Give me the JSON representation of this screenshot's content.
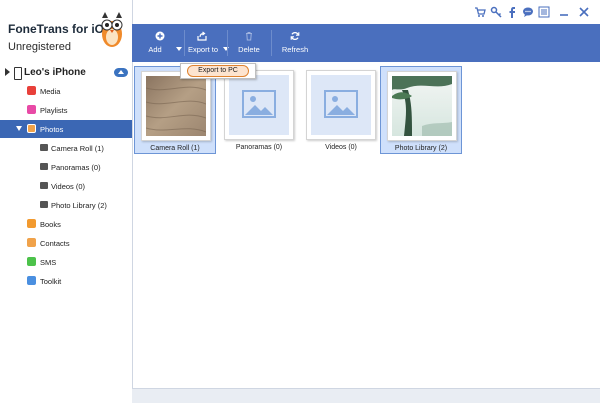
{
  "app": {
    "name": "FoneTrans for iOS",
    "status": "Unregistered"
  },
  "device": {
    "name": "Leo's iPhone"
  },
  "sidebar": {
    "items": [
      {
        "label": "Media",
        "icon": "media-icon",
        "color": "#e8403a"
      },
      {
        "label": "Playlists",
        "icon": "playlist-icon",
        "color": "#e84aa6"
      },
      {
        "label": "Photos",
        "icon": "photos-icon",
        "color": "#f0a24a"
      },
      {
        "label": "Camera Roll (1)",
        "icon": "camera-icon"
      },
      {
        "label": "Panoramas (0)",
        "icon": "camera-icon"
      },
      {
        "label": "Videos (0)",
        "icon": "camera-icon"
      },
      {
        "label": "Photo Library (2)",
        "icon": "camera-icon"
      },
      {
        "label": "Books",
        "icon": "books-icon",
        "color": "#f29a2f"
      },
      {
        "label": "Contacts",
        "icon": "contacts-icon",
        "color": "#f0a24a"
      },
      {
        "label": "SMS",
        "icon": "sms-icon",
        "color": "#4cc24a"
      },
      {
        "label": "Toolkit",
        "icon": "toolkit-icon",
        "color": "#4a8fe0"
      }
    ]
  },
  "toolbar": {
    "add": "Add",
    "export": "Export to",
    "delete": "Delete",
    "refresh": "Refresh",
    "background": "#4a6fbe"
  },
  "dropdown": {
    "export_pc": "Export to PC"
  },
  "albums": [
    {
      "caption": "Camera Roll (1)",
      "kind": "photo-wood"
    },
    {
      "caption": "Panoramas (0)",
      "kind": "placeholder"
    },
    {
      "caption": "Videos (0)",
      "kind": "placeholder"
    },
    {
      "caption": "Photo Library (2)",
      "kind": "photo-tree"
    }
  ]
}
